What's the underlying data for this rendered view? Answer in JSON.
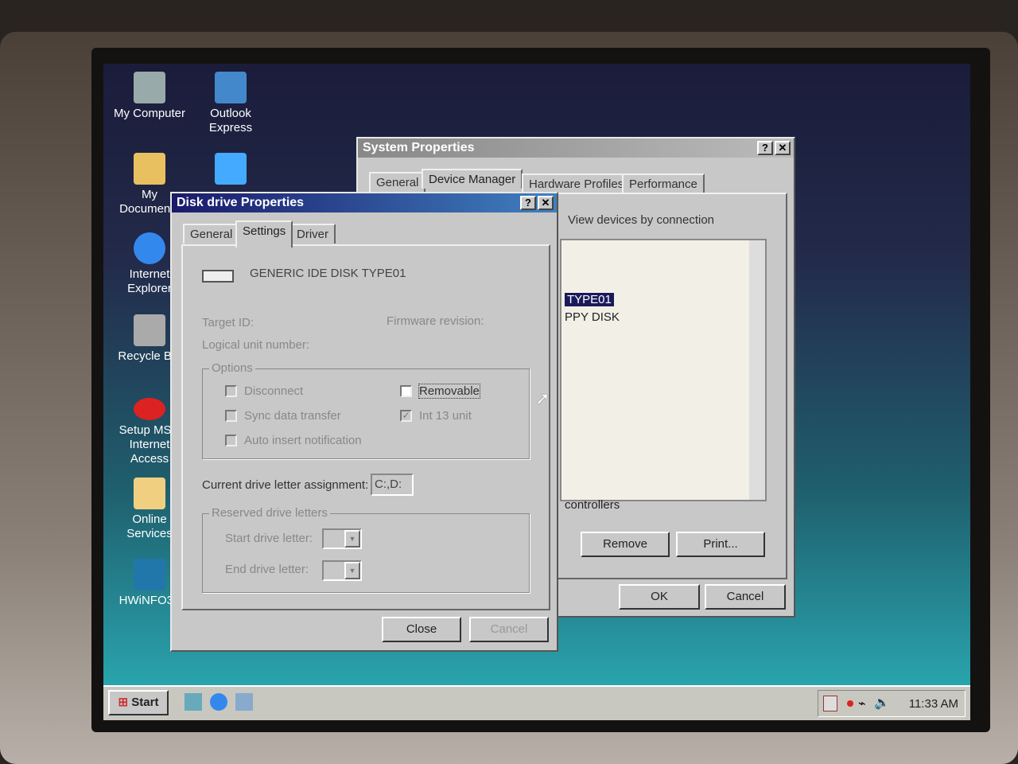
{
  "desktop": {
    "icons": [
      {
        "label": "My Computer",
        "color": "#9aa"
      },
      {
        "label": "Outlook Express",
        "color": "#48c"
      },
      {
        "label": "My Documents",
        "color": "#e8c060"
      },
      {
        "label": "",
        "color": "#4af"
      },
      {
        "label": "Internet Explorer",
        "color": "#38e"
      },
      {
        "label": "Recycle Bin",
        "color": "#aaa"
      },
      {
        "label": "Setup MSN Internet Access",
        "color": "#d22"
      },
      {
        "label": "Online Services",
        "color": "#f0d080"
      },
      {
        "label": "HWiNFO32",
        "color": "#27a"
      }
    ]
  },
  "system_properties": {
    "title": "System Properties",
    "tabs": [
      "General",
      "Device Manager",
      "Hardware Profiles",
      "Performance"
    ],
    "view_option": "View devices by connection",
    "tree_items": [
      "TYPE01",
      "PPY DISK",
      "controllers"
    ],
    "buttons": {
      "remove": "Remove",
      "print": "Print...",
      "ok": "OK",
      "cancel": "Cancel"
    }
  },
  "disk_properties": {
    "title": "Disk drive Properties",
    "tabs": [
      "General",
      "Settings",
      "Driver"
    ],
    "device_name": "GENERIC IDE  DISK TYPE01",
    "target_id": "Target ID:",
    "firmware": "Firmware revision:",
    "lun": "Logical unit number:",
    "options_label": "Options",
    "options": {
      "disconnect": "Disconnect",
      "sync": "Sync data transfer",
      "auto_insert": "Auto insert notification",
      "removable": "Removable",
      "int13": "Int 13 unit"
    },
    "int13_checked": true,
    "current_letter_label": "Current drive letter assignment:",
    "current_letter": "C:,D:",
    "reserved_label": "Reserved drive letters",
    "start_label": "Start drive letter:",
    "end_label": "End drive letter:",
    "buttons": {
      "close": "Close",
      "cancel": "Cancel"
    }
  },
  "taskbar": {
    "start": "Start",
    "clock": "11:33 AM"
  }
}
